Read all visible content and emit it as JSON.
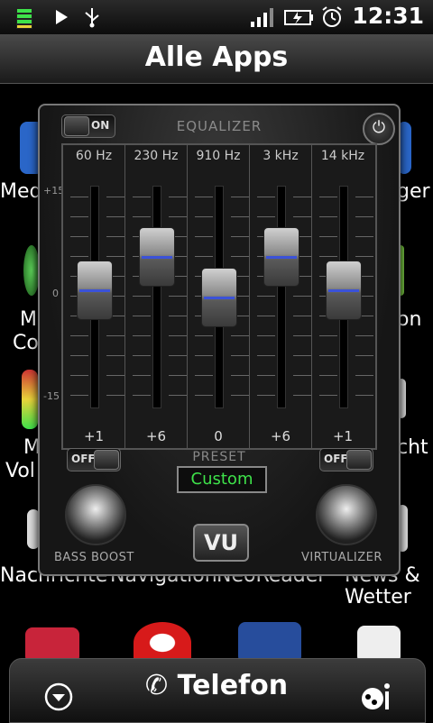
{
  "status_bar": {
    "time": "12:31",
    "icons": [
      "battery-level-icon",
      "play-icon",
      "usb-icon",
      "signal-icon",
      "charging-battery-icon",
      "alarm-icon"
    ]
  },
  "title_bar": {
    "title": "Alle Apps"
  },
  "background_apps": {
    "row1": [
      "Med",
      "ger"
    ],
    "row2": [
      "M",
      "Co",
      "on"
    ],
    "row3": [
      "M",
      "Vol",
      "cht"
    ],
    "row4": [
      "Nachrichte",
      "Navigation",
      "NeoReader",
      "News &",
      "Wetter"
    ]
  },
  "dock": {
    "phone_label": "Telefon"
  },
  "equalizer": {
    "title": "EQUALIZER",
    "main_toggle": "ON",
    "scale": {
      "top": "+15",
      "mid": "0",
      "bottom": "-15"
    },
    "bands": [
      {
        "freq": "60 Hz",
        "gain_label": "+1",
        "level": 1
      },
      {
        "freq": "230 Hz",
        "gain_label": "+6",
        "level": 6
      },
      {
        "freq": "910 Hz",
        "gain_label": "0",
        "level": 0
      },
      {
        "freq": "3 kHz",
        "gain_label": "+6",
        "level": 6
      },
      {
        "freq": "14 kHz",
        "gain_label": "+1",
        "level": 1
      }
    ],
    "preset_label": "PRESET",
    "preset_value": "Custom",
    "bass_boost_toggle": "OFF",
    "virtualizer_toggle": "OFF",
    "bass_boost_label": "BASS BOOST",
    "virtualizer_label": "VIRTUALIZER",
    "vu_label": "VU",
    "accent_color": "#3ee24a",
    "slider_line_color": "#3b52d8"
  }
}
